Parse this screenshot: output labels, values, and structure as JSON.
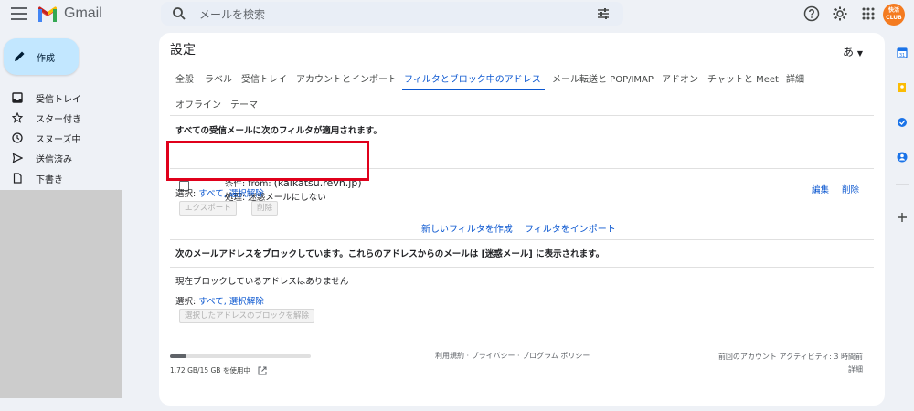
{
  "app": {
    "name": "Gmail",
    "search_placeholder": "メールを検索"
  },
  "nav": {
    "compose_label": "作成",
    "items": [
      {
        "label": "受信トレイ",
        "icon": "inbox-icon"
      },
      {
        "label": "スター付き",
        "icon": "star-icon"
      },
      {
        "label": "スヌーズ中",
        "icon": "clock-icon"
      },
      {
        "label": "送信済み",
        "icon": "send-icon"
      },
      {
        "label": "下書き",
        "icon": "draft-icon"
      }
    ]
  },
  "avatar": {
    "line1": "快活",
    "line2": "CLUB"
  },
  "settings": {
    "title": "設定",
    "input_tools": "あ",
    "tabs": [
      {
        "label": "全般"
      },
      {
        "label": "ラベル"
      },
      {
        "label": "受信トレイ"
      },
      {
        "label": "アカウントとインポート"
      },
      {
        "label": "フィルタとブロック中のアドレス",
        "active": true
      },
      {
        "label": "メール転送と POP/IMAP"
      },
      {
        "label": "アドオン"
      },
      {
        "label": "チャットと Meet"
      },
      {
        "label": "詳細"
      },
      {
        "label": "オフライン"
      },
      {
        "label": "テーマ"
      }
    ],
    "filters_heading": "すべての受信メールに次のフィルタが適用されます。",
    "filter": {
      "condition_prefix": "条件: from:",
      "condition_value": "(kaikatsu.revn.jp)",
      "action": "処理: 迷惑メールにしない",
      "edit": "編集",
      "delete": "削除"
    },
    "select_label": "選択:",
    "select_all": "すべて,",
    "select_none": "選択解除",
    "export_button": "エクスポート",
    "delete_button": "削除",
    "create_filter": "新しいフィルタを作成",
    "import_filter": "フィルタをインポート",
    "blocked_heading": "次のメールアドレスをブロックしています。これらのアドレスからのメールは [迷惑メール] に表示されます。",
    "no_blocked": "現在ブロックしているアドレスはありません",
    "unblock_button": "選択したアドレスのブロックを解除"
  },
  "footer": {
    "storage_text": "1.72 GB/15 GB を使用中",
    "storage_fraction": 0.115,
    "policy": "利用規約 · プライバシー · プログラム ポリシー",
    "activity": "前回のアカウント アクティビティ: 3 時間前",
    "details": "詳細"
  },
  "colors": {
    "accent": "#0b57d0",
    "highlight_box": "#e0001b",
    "compose_bg": "#c2e7ff"
  }
}
